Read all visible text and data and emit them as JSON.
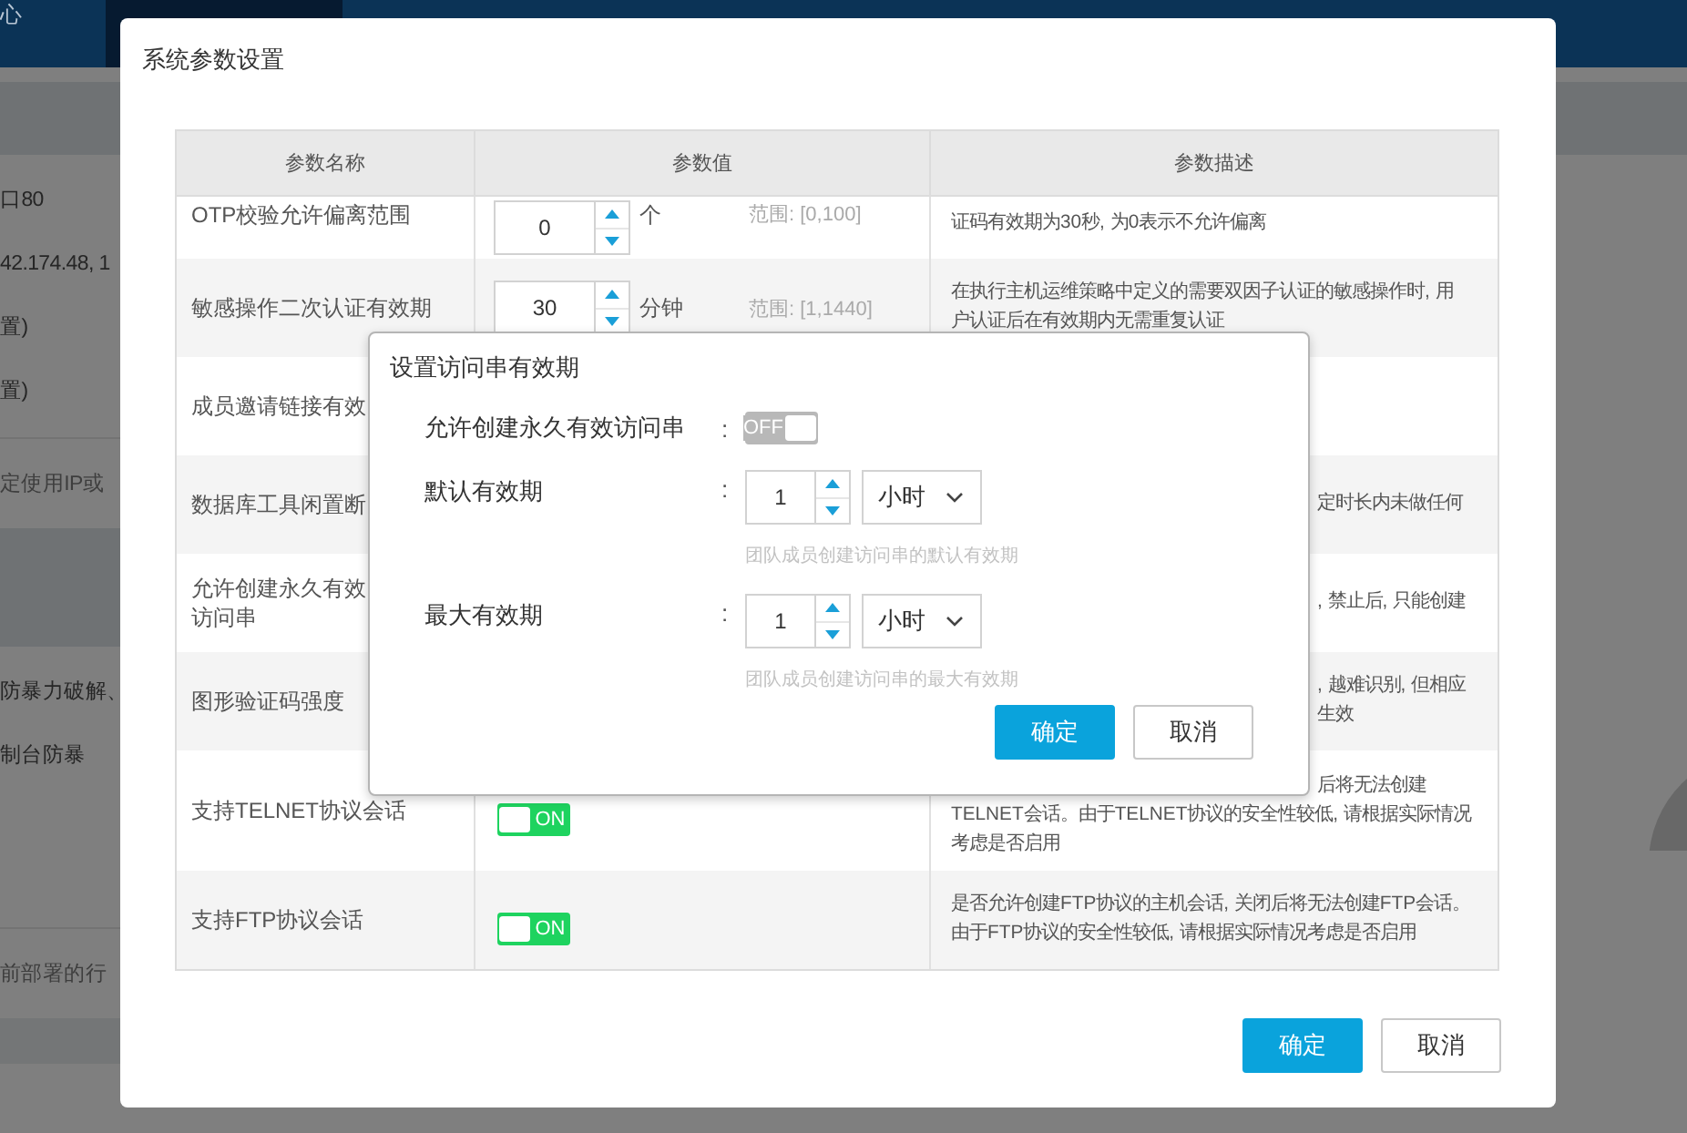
{
  "background": {
    "nav_label": "心",
    "side_groups": [
      [
        {
          "text": "口80",
          "kind": "label"
        },
        {
          "text": "42.174.48, 1",
          "kind": "label"
        },
        {
          "text": "置)",
          "kind": "label"
        },
        {
          "text": "置)",
          "kind": "label"
        },
        {
          "text": "定使用IP或",
          "kind": "hint"
        }
      ],
      [
        {
          "text": "防暴力破解、",
          "kind": "label"
        },
        {
          "text": "制台防暴",
          "kind": "label"
        },
        {
          "text": "前部署的行",
          "kind": "hint"
        }
      ]
    ]
  },
  "modal": {
    "title": "系统参数设置",
    "table": {
      "columns": [
        "参数名称",
        "参数值",
        "参数描述"
      ],
      "rows": [
        {
          "name_lines": [
            "OTP校验允许偏离范围"
          ],
          "value": {
            "kind": "number",
            "value": "0",
            "unit": "个",
            "range": "范围: [0,100]"
          },
          "description_lines": [
            "证码有效期为30秒, 为0表示不允许偏离"
          ]
        },
        {
          "name_lines": [
            "敏感操作二次认证有效期"
          ],
          "value": {
            "kind": "number",
            "value": "30",
            "unit": "分钟",
            "range": "范围: [1,1440]"
          },
          "description_lines": [
            "在执行主机运维策略中定义的需要双因子认证的敏感操作时, 用",
            "户认证后在有效期内无需重复认证"
          ]
        },
        {
          "name_lines": [
            "成员邀请链接有效"
          ]
        },
        {
          "name_lines": [
            "数据库工具闲置断"
          ],
          "description_lines": [
            "定时长内未做任何"
          ]
        },
        {
          "name_lines": [
            "允许创建永久有效",
            "访问串"
          ],
          "description_lines": [
            ", 禁止后, 只能创建"
          ]
        },
        {
          "name_lines": [
            "图形验证码强度"
          ],
          "description_lines": [
            ", 越难识别, 但相应",
            "生效"
          ]
        },
        {
          "name_lines": [
            "支持TELNET协议会话"
          ],
          "value": {
            "kind": "toggle",
            "on": true,
            "label": "ON"
          },
          "description_lines": [
            "后将无法创建",
            "TELNET会话。由于TELNET协议的安全性较低, 请根据实际情况",
            "考虑是否启用"
          ]
        },
        {
          "name_lines": [
            "支持FTP协议会话"
          ],
          "value": {
            "kind": "toggle",
            "on": true,
            "label": "ON"
          },
          "description_lines": [
            "是否允许创建FTP协议的主机会话, 关闭后将无法创建FTP会话。",
            "由于FTP协议的安全性较低, 请根据实际情况考虑是否启用"
          ]
        }
      ]
    },
    "buttons": [
      {
        "label": "确定",
        "kind": "primary"
      },
      {
        "label": "取消",
        "kind": "secondary"
      }
    ]
  },
  "dialog": {
    "title": "设置访问串有效期",
    "fields": [
      {
        "kind": "toggle",
        "label": "允许创建永久有效访问串",
        "colon": ":",
        "on": false,
        "toggle_label": "OFF"
      },
      {
        "kind": "duration",
        "label": "默认有效期",
        "colon": ":",
        "value": "1",
        "unit": "小时",
        "hint": "团队成员创建访问串的默认有效期"
      },
      {
        "kind": "duration",
        "label": "最大有效期",
        "colon": ":",
        "value": "1",
        "unit": "小时",
        "hint": "团队成员创建访问串的最大有效期"
      }
    ],
    "buttons": [
      {
        "label": "确定",
        "kind": "primary"
      },
      {
        "label": "取消",
        "kind": "secondary"
      }
    ]
  }
}
